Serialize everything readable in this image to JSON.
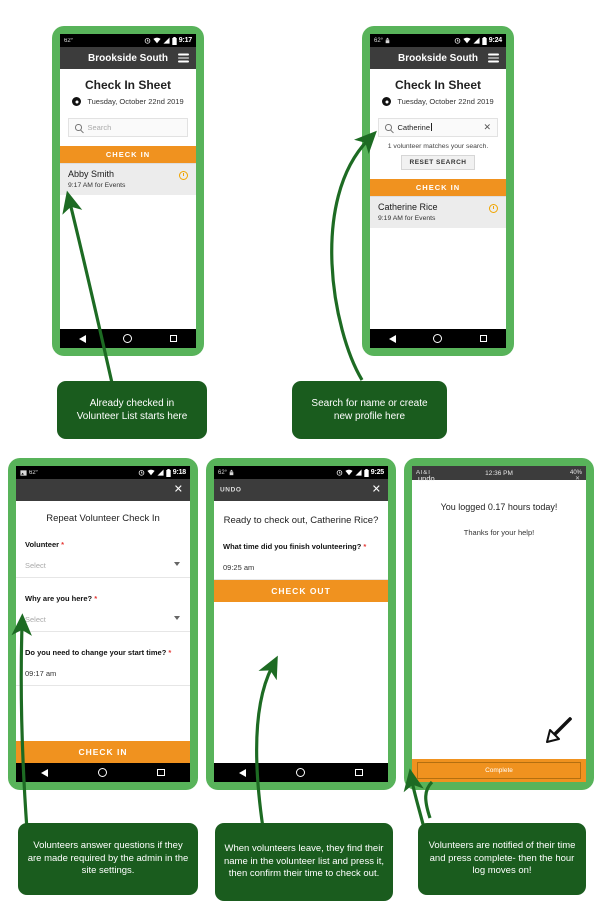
{
  "colors": {
    "frame_green": "#58b35a",
    "callout_green": "#1a5c1e",
    "accent_orange": "#f0921f",
    "appbar_gray": "#3c3c3c",
    "badge_orange": "#f0a500"
  },
  "screens": {
    "checkin_list": {
      "status": {
        "left_label": "62°",
        "time": "9:17",
        "icons": [
          "alarm-icon",
          "wifi-icon",
          "signal-icon",
          "battery-icon"
        ]
      },
      "appbar": {
        "title": "Brookside South",
        "menu_icon": "hamburger-icon"
      },
      "sheet_title": "Check In Sheet",
      "sheet_date": "Tuesday, October 22nd 2019",
      "search": {
        "placeholder": "Search",
        "value": ""
      },
      "checkin_button": "CHECK IN",
      "volunteers": [
        {
          "name": "Abby Smith",
          "detail": "9:17 AM  for Events",
          "badge": "history-icon"
        }
      ]
    },
    "search_result": {
      "status": {
        "left_label": "62°",
        "time": "9:24",
        "icons": [
          "upload-icon",
          "alarm-icon",
          "wifi-icon",
          "signal-icon",
          "battery-icon"
        ]
      },
      "appbar": {
        "title": "Brookside South",
        "menu_icon": "hamburger-icon"
      },
      "sheet_title": "Check In Sheet",
      "sheet_date": "Tuesday, October 22nd 2019",
      "search": {
        "placeholder": "Search",
        "value": "Catherine"
      },
      "match_note": "1 volunteer matches your search.",
      "reset_button": "RESET SEARCH",
      "checkin_button": "CHECK IN",
      "volunteers": [
        {
          "name": "Catherine Rice",
          "detail": "9:19 AM  for Events",
          "badge": "history-icon"
        }
      ]
    },
    "repeat_form": {
      "status": {
        "left_label": "62°",
        "time": "9:18",
        "icons": [
          "image-icon",
          "alarm-icon",
          "wifi-icon",
          "signal-icon",
          "battery-icon"
        ]
      },
      "appbar": {
        "title": "",
        "close_icon": "close-icon"
      },
      "form_title": "Repeat Volunteer Check In",
      "fields": [
        {
          "label": "Volunteer",
          "required": true,
          "value": "Select",
          "type": "select",
          "filled": false
        },
        {
          "label": "Why are you here?",
          "required": true,
          "value": "Select",
          "type": "select",
          "filled": false
        },
        {
          "label": "Do you need to change your start time?",
          "required": true,
          "value": "09:17 am",
          "type": "time",
          "filled": true
        }
      ],
      "cta": "CHECK IN"
    },
    "checkout_form": {
      "status": {
        "left_label": "62°",
        "time": "9:25",
        "icons": [
          "upload-icon",
          "alarm-icon",
          "wifi-icon",
          "signal-icon",
          "battery-icon"
        ]
      },
      "appbar": {
        "undo_label": "UNDO",
        "close_icon": "close-icon"
      },
      "ready_title": "Ready to check out, Catherine Rice?",
      "fields": [
        {
          "label": "What time did you finish volunteering?",
          "required": true,
          "value": "09:25 am",
          "type": "time",
          "filled": true
        }
      ],
      "cta": "CHECK OUT"
    },
    "confirmation": {
      "status": {
        "carrier": "AT&T",
        "time": "12:36 PM",
        "battery": "40%"
      },
      "undo_label": "undo",
      "close_icon": "close-icon",
      "logged_message": "You logged 0.17 hours today!",
      "thanks_message": "Thanks for your help!",
      "cursor_icon": "pointer-arrow-icon",
      "complete_button": "Complete"
    }
  },
  "callouts": [
    {
      "id": "callout-checked-in",
      "text": "Already checked in\nVolunteer List starts here"
    },
    {
      "id": "callout-search",
      "text": "Search for name or create\nnew profile here"
    },
    {
      "id": "callout-questions",
      "text": "Volunteers answer questions if they are made required by the admin in the site settings."
    },
    {
      "id": "callout-checkout",
      "text": "When volunteers leave, they find their name in the volunteer list and press it, then confirm their time to check out."
    },
    {
      "id": "callout-complete",
      "text": "Volunteers are notified of their time and press complete- then the hour log moves on!"
    }
  ]
}
